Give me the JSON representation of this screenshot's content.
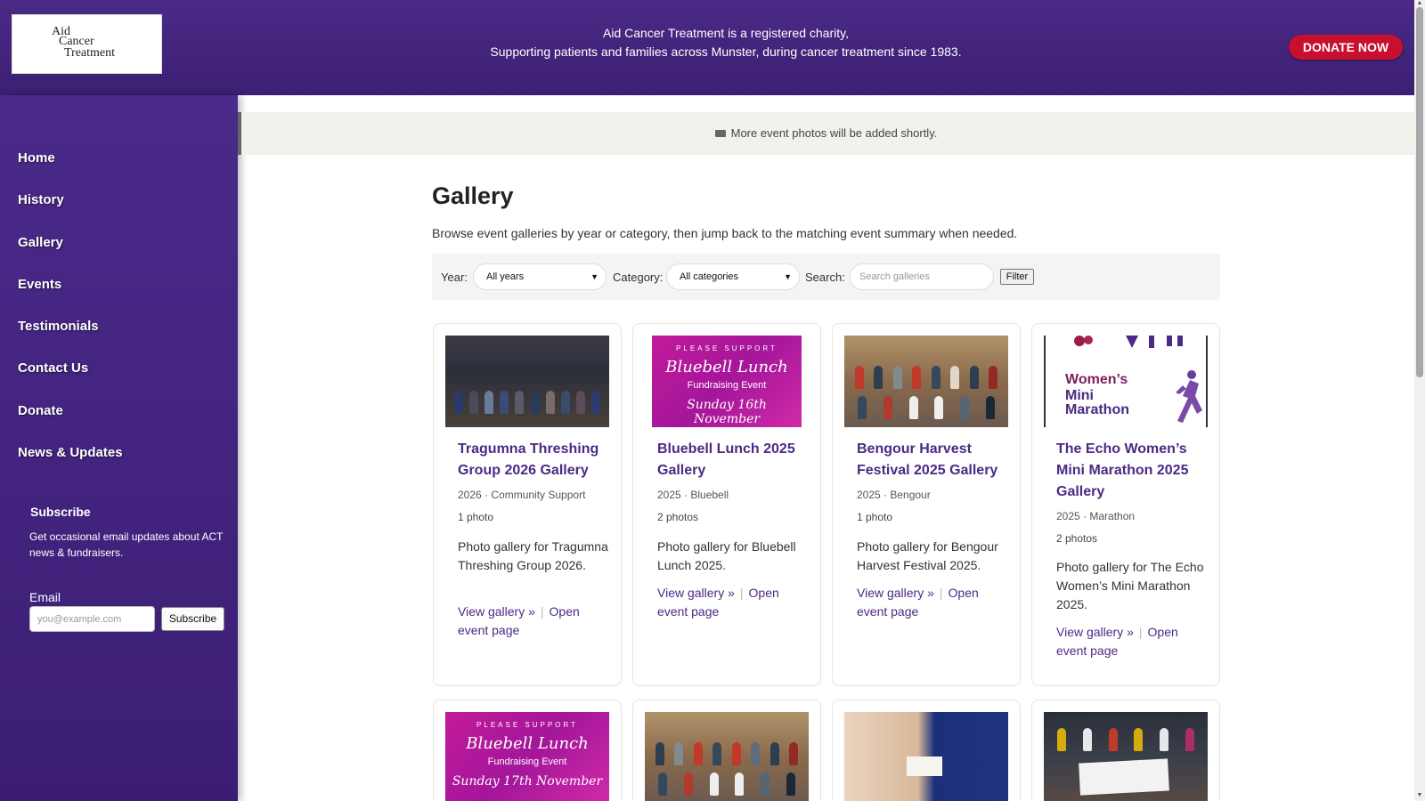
{
  "header": {
    "logo_line1": "Aid",
    "logo_line2": "Cancer",
    "logo_line3": "Treatment",
    "tagline_1": "Aid Cancer Treatment is a registered charity,",
    "tagline_2": "Supporting patients and families across Munster, during cancer treatment since 1983.",
    "donate_label": "DONATE NOW"
  },
  "sidebar": {
    "items": [
      {
        "label": "Home"
      },
      {
        "label": "History"
      },
      {
        "label": "Gallery"
      },
      {
        "label": "Events"
      },
      {
        "label": "Testimonials"
      },
      {
        "label": "Contact Us"
      },
      {
        "label": "Donate"
      },
      {
        "label": "News & Updates"
      }
    ],
    "subscribe_title": "Subscribe",
    "subscribe_desc": "Get occasional email updates about ACT news & fundraisers.",
    "email_label": "Email",
    "email_placeholder": "you@example.com",
    "subscribe_button": "Subscribe"
  },
  "notice": {
    "text": "More event photos will be added shortly."
  },
  "main": {
    "title": "Gallery",
    "description": "Browse event galleries by year or category, then jump back to the matching event summary when needed.",
    "filters": {
      "year_label": "Year:",
      "year_value": "All years",
      "category_label": "Category:",
      "category_value": "All categories",
      "search_label": "Search:",
      "search_placeholder": "Search galleries",
      "filter_button": "Filter"
    }
  },
  "cards": [
    {
      "title": "Tragumna Threshing Group 2026 Gallery",
      "meta": "2026 · Community Support",
      "count": "1 photo",
      "desc": "Photo gallery for Tragumna Threshing Group 2026.",
      "view": "View gallery »",
      "open": "Open event page"
    },
    {
      "title": "Bluebell Lunch 2025 Gallery",
      "meta": "2025 · Bluebell",
      "count": "2 photos",
      "desc": "Photo gallery for Bluebell Lunch 2025.",
      "view": "View gallery »",
      "open": "Open event page",
      "thumb": {
        "pls": "PLEASE SUPPORT",
        "bb": "Bluebell Lunch",
        "fe": "Fundraising Event",
        "sun": "Sunday 16th November"
      }
    },
    {
      "title": "Bengour Harvest Festival 2025 Gallery",
      "meta": "2025 · Bengour",
      "count": "1 photo",
      "desc": "Photo gallery for Bengour Harvest Festival 2025.",
      "view": "View gallery »",
      "open": "Open event page"
    },
    {
      "title": "The Echo Women’s Mini Marathon 2025 Gallery",
      "meta": "2025 · Marathon",
      "count": "2 photos",
      "desc": "Photo gallery for The Echo Women’s Mini Marathon 2025.",
      "view": "View gallery »",
      "open": "Open event page",
      "thumb": {
        "l1": "Women’s",
        "l2": "Mini",
        "l3": "Marathon"
      }
    },
    {
      "thumb": {
        "pls": "PLEASE SUPPORT",
        "bb": "Bluebell Lunch",
        "fe": "Fundraising Event",
        "sun": "Sunday 17th November"
      }
    },
    {},
    {},
    {}
  ],
  "colors": {
    "brand_purple": "#4a2a86",
    "donate_red": "#c8102e",
    "link_purple": "#4b2a84"
  }
}
